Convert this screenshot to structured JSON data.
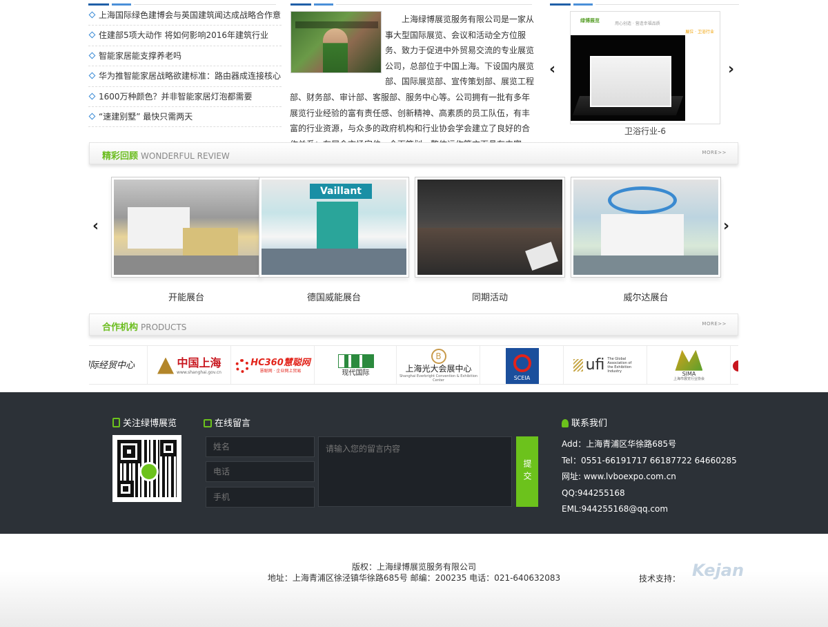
{
  "news": {
    "items": [
      "上海国际绿色建博会与英国建筑闻达成战略合作意向",
      "住建部5项大动作 将如何影响2016年建筑行业",
      "智能家居能支撑养老吗",
      "华为推智能家居战略欲建标准：路由器成连接核心",
      "1600万种颜色？并非智能家居灯泡都需要",
      "“速建别墅” 最快只需两天"
    ]
  },
  "about": {
    "text": "上海绿博展览服务有限公司是一家从事大型国际展览、会议和活动全方位服务、致力于促进中外贸易交流的专业展览公司，总部位于中国上海。下设国内展览部、国际展览部、宣传策划部、展览工程部、财务部、审计部、客服部、服务中心等。公司拥有一批有多年展览行业经验的富有责任感、创新精神、高素质的员工队伍，有丰富的行业资源，与众多的政府机构和行业协会学会建立了良好的合作关系；在展会市场定位、全面策划、整体运作等方面具有丰富的..."
  },
  "featured": {
    "caption": "卫浴行业-6",
    "brand": "绿博展览",
    "slogan": "用心创造 · 营造幸福品质",
    "tag": "展位 · 卫浴行业"
  },
  "review": {
    "title_cn": "精彩回顾",
    "title_en": "WONDERFUL REVIEW",
    "more": "MORE>>",
    "items": [
      "开能展台",
      "德国威能展台",
      "同期活动",
      "威尔达展台"
    ]
  },
  "partners": {
    "title_cn": "合作机构",
    "title_en": "PRODUCTS",
    "more": "MORE>>",
    "logos": [
      "国际经贸中心",
      "中国上海",
      "HC360慧聪网",
      "现代国际",
      "上海光大会展中心",
      "SCEIA",
      "ufi",
      "SIMA"
    ],
    "logo_subs": {
      "shanghai": "www.shanghai.gov.cn",
      "hc360": "慧聪网 · 企业网上贸易",
      "everbright": "Shanghai Everbright Convention & Exhibition Center",
      "ufi": "The Global Association of the Exhibition Industry",
      "sima": "上海市展览行业协会"
    }
  },
  "footer": {
    "follow_title": "关注绿博展览",
    "message_title": "在线留言",
    "contact_title": "联系我们",
    "name_placeholder": "姓名",
    "phone_placeholder": "电话",
    "mobile_placeholder": "手机",
    "message_placeholder": "请输入您的留言内容",
    "submit": "提交",
    "contact": {
      "address": "Add：上海青浦区华徐路685号",
      "tel": "Tel：0551-66191717 66187722 64660285",
      "web": "网址: www.lvboexpo.com.cn",
      "qq": "QQ:944255168",
      "email": "EML:944255168@qq.com"
    }
  },
  "copyright": {
    "line1": "版权：上海绿博展览服务有限公司",
    "line2": "地址：上海青浦区徐泾镇华徐路685号 邮编：200235 电话：021-640632083",
    "tech": "技术支持：",
    "tech_logo": "Kejan"
  },
  "colors": {
    "accent_green": "#6cc21c",
    "footer_bg": "#2c3137",
    "accent_blue": "#1f5fa8"
  }
}
